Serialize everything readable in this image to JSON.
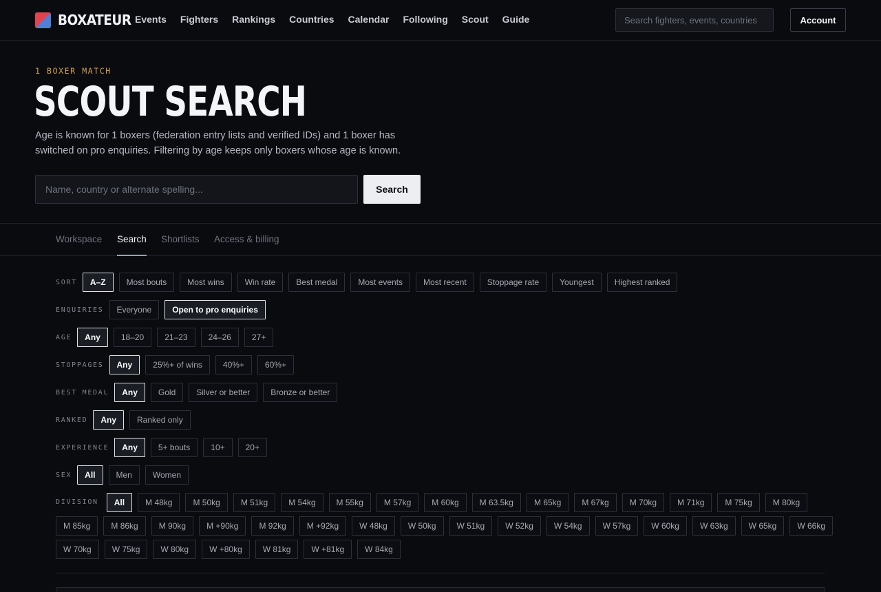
{
  "brand": {
    "name": "BOXATEUR"
  },
  "nav": [
    "Events",
    "Fighters",
    "Rankings",
    "Countries",
    "Calendar",
    "Following",
    "Scout",
    "Guide"
  ],
  "header": {
    "search_placeholder": "Search fighters, events, countries",
    "account_label": "Account"
  },
  "hero": {
    "eyebrow": "1 BOXER MATCH",
    "title": "SCOUT SEARCH",
    "description": "Age is known for 1 boxers (federation entry lists and verified IDs) and 1 boxer has switched on pro enquiries. Filtering by age keeps only boxers whose age is known.",
    "search_placeholder": "Name, country or alternate spelling...",
    "search_button": "Search"
  },
  "tabs": [
    {
      "label": "Workspace",
      "active": false
    },
    {
      "label": "Search",
      "active": true
    },
    {
      "label": "Shortlists",
      "active": false
    },
    {
      "label": "Access & billing",
      "active": false
    }
  ],
  "filters": {
    "sort": {
      "label": "SORT",
      "options": [
        "A–Z",
        "Most bouts",
        "Most wins",
        "Win rate",
        "Best medal",
        "Most events",
        "Most recent",
        "Stoppage rate",
        "Youngest",
        "Highest ranked"
      ],
      "selected": "A–Z"
    },
    "enquiries": {
      "label": "ENQUIRIES",
      "options": [
        "Everyone",
        "Open to pro enquiries"
      ],
      "selected": "Open to pro enquiries"
    },
    "age": {
      "label": "AGE",
      "options": [
        "Any",
        "18–20",
        "21–23",
        "24–26",
        "27+"
      ],
      "selected": "Any"
    },
    "stoppages": {
      "label": "STOPPAGES",
      "options": [
        "Any",
        "25%+ of wins",
        "40%+",
        "60%+"
      ],
      "selected": "Any"
    },
    "best_medal": {
      "label": "BEST MEDAL",
      "options": [
        "Any",
        "Gold",
        "Silver or better",
        "Bronze or better"
      ],
      "selected": "Any"
    },
    "ranked": {
      "label": "RANKED",
      "options": [
        "Any",
        "Ranked only"
      ],
      "selected": "Any"
    },
    "experience": {
      "label": "EXPERIENCE",
      "options": [
        "Any",
        "5+ bouts",
        "10+",
        "20+"
      ],
      "selected": "Any"
    },
    "sex": {
      "label": "SEX",
      "options": [
        "All",
        "Men",
        "Women"
      ],
      "selected": "All"
    },
    "division": {
      "label": "DIVISION",
      "selected": "All",
      "lines": [
        [
          "All",
          "M 48kg",
          "M 50kg",
          "M 51kg",
          "M 54kg",
          "M 55kg",
          "M 57kg",
          "M 60kg",
          "M 63.5kg",
          "M 65kg",
          "M 67kg",
          "M 70kg",
          "M 71kg",
          "M 75kg",
          "M 80kg"
        ],
        [
          "M 85kg",
          "M 86kg",
          "M 90kg",
          "M +90kg",
          "M 92kg",
          "M +92kg",
          "W 48kg",
          "W 50kg",
          "W 51kg",
          "W 52kg",
          "W 54kg",
          "W 57kg",
          "W 60kg",
          "W 63kg",
          "W 65kg",
          "W 66kg"
        ],
        [
          "W 70kg",
          "W 75kg",
          "W 80kg",
          "W +80kg",
          "W 81kg",
          "W +81kg",
          "W 84kg"
        ]
      ]
    }
  },
  "colors": {
    "background": "#0a0b0f",
    "accent": "#d6a24a",
    "logo_red": "#e2434f",
    "logo_blue": "#4f7fd6"
  }
}
